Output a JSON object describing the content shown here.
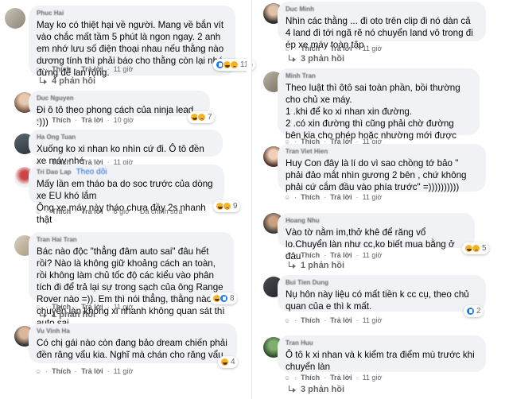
{
  "left": {
    "comments": [
      {
        "author": "Phuc Hai",
        "text": "May ko có thiệt hại về người. Mang về bắn vít vào chắc mất tầm 5 phút là ngon ngay. 2 anh em nhớ lưu số điện thoại nhau nếu thằng nào dương tính thì phải báo cho thằng còn lại nhé đừng để lan rộng.",
        "like": "Thích",
        "reply": "Trả lời",
        "time": "11 giờ",
        "reactions": "115",
        "replies": "4 phản hồi"
      },
      {
        "author": "Duc Nguyen",
        "text": "Đi ô tô theo phong cách của ninja lead. :)))",
        "like": "Thích",
        "reply": "Trả lời",
        "time": "10 giờ",
        "reactions": "7"
      },
      {
        "author": "Ha Ong Tuan",
        "text": "Xuống ko xi nhan ko nhìn cứ đi. Ô tô đền xe máy nhé",
        "like": "Thích",
        "reply": "Trả lời",
        "time": "11 giờ"
      },
      {
        "author": "Tri Dao Lap",
        "follow": "Theo dõi",
        "text": "Mấy lần em tháo ba do soc trước của dòng xe EU khó lắm\nÔng xe máy này tháo chưa đầy 2s nhanh thật",
        "like": "Thích",
        "reply": "Trả lời",
        "time": "8 giờ",
        "edited": "Đã chỉnh sửa",
        "reactions": "9"
      },
      {
        "author": "Tran Hai Tran",
        "text": "Bác nào độc \"thẳng đâm auto sai\" đâu hết rồi? Nào là không giữ khoảng cách an toàn, rồi không làm chủ tốc độ các kiểu vào phân tích đi để trả lại sự trong sạch của ông Range Rover nào =)). Em thì nói thẳng, thằng nào chuyển làn không xi nhanh không quan sát thì auto sai.",
        "like": "Thích",
        "reply": "Trả lời",
        "time": "11 giờ",
        "reactions": "8",
        "replies": "1 phản hồi"
      },
      {
        "author": "Vu Vinh Ha",
        "text": "Có chị gái nào còn đang bảo dream chiến phải đền răng vẩu kia. Nghĩ mà chán cho răng vẩu",
        "like": "Thích",
        "reply": "Trả lời",
        "time": "11 giờ",
        "reactions": "4"
      }
    ]
  },
  "right": {
    "comments": [
      {
        "author": "Duc Minh",
        "text": "Nhìn các thằng ... đi oto trên clip đi nó dàn cả 4 land đi tới ngã rẽ nó chuyển land vô trong đi ép xe máy toàn tập",
        "like": "Thích",
        "reply": "Trả lời",
        "time": "11 giờ",
        "replies": "3 phản hồi"
      },
      {
        "author": "Minh Tran",
        "text": "Theo luật thì ôtô sai toàn phần, bồi thường cho chủ xe máy.\n1 .khi để ko xi nhan xin đường.\n2 .có xin đường thì cũng phải chờ đường bên kia cho phép hoặc nhường mới được sang.",
        "like": "Thích",
        "reply": "Trả lời",
        "time": "11 giờ"
      },
      {
        "author": "Tran Viet Hien",
        "text": "Huy Con đây là lí do vì sao chồng tớ bảo \" phải đảo mắt nhìn gương 2 bên , chứ không phải cứ cắm đầu vào phía trước\" =))))))))))",
        "like": "Thích",
        "reply": "Trả lời",
        "time": "11 giờ"
      },
      {
        "author": "Hoang Nhu",
        "text": "Vào tờ nằm im,thở khê để răng vổ lo.Chuyển làn như cc,ko biết mua bằng ở đâu",
        "like": "Thích",
        "reply": "Trả lời",
        "time": "11 giờ",
        "reactions": "5",
        "replies": "1 phản hồi"
      },
      {
        "author": "Bui Tien Dung",
        "text": "Nụ hôn này liệu có mất tiền k cc cụ, theo chủ quan của e thì k mất.",
        "like": "Thích",
        "reply": "Trả lời",
        "time": "11 giờ",
        "reactions": "2"
      },
      {
        "author": "Tran Huu",
        "text": "Ô tô k xi nhan và k kiểm tra điểm mù trước khi chuyển làn",
        "like": "Thích",
        "reply": "Trả lời",
        "time": "11 giờ",
        "replies": "3 phản hồi"
      }
    ]
  },
  "colors": {
    "bubble": "#f0f2f5",
    "meta": "#65676b",
    "follow": "#216fdb",
    "like": "#1877f2",
    "haha": "#f7b125"
  }
}
